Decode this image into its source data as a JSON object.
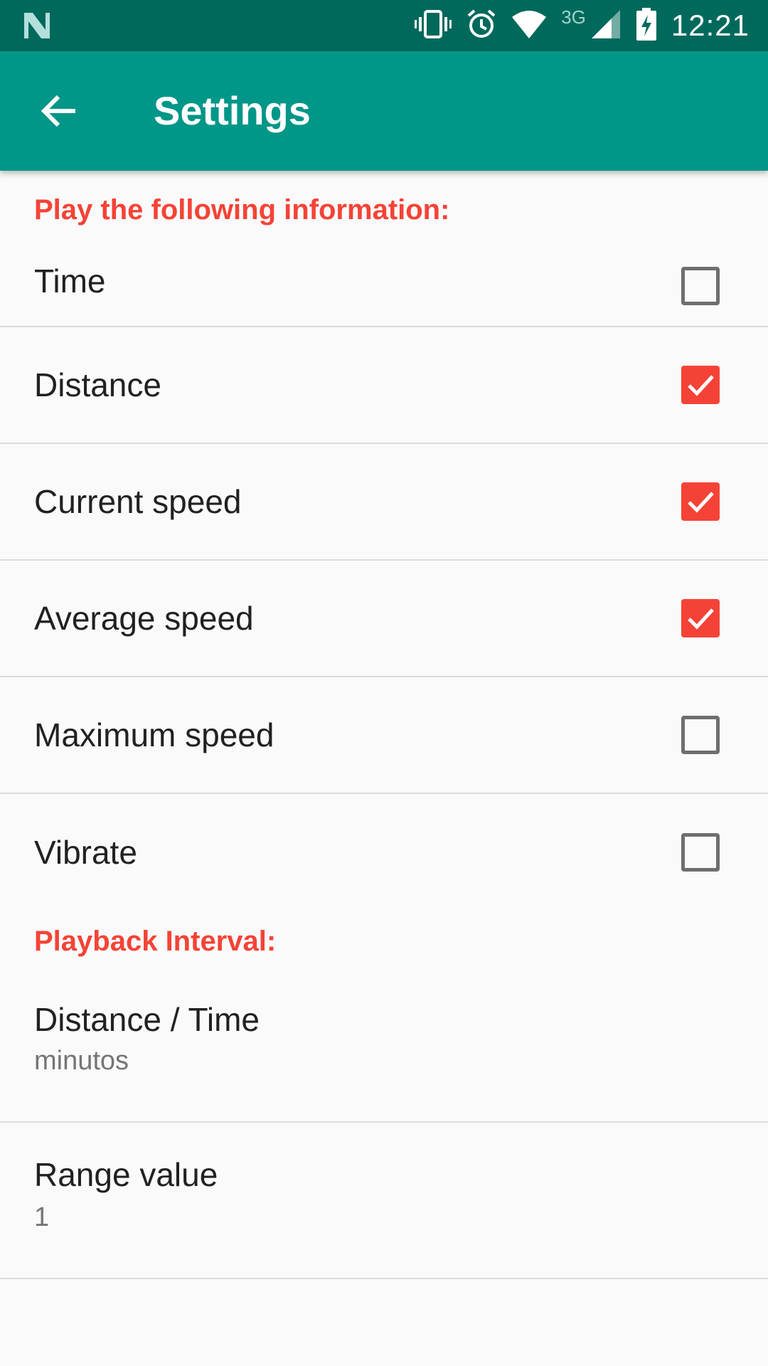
{
  "status_bar": {
    "left_icon": "notification-n-icon",
    "icons": [
      "vibrate-icon",
      "alarm-icon",
      "wifi-icon",
      "signal-icon",
      "battery-charging-icon"
    ],
    "network_type": "3G",
    "time": "12:21"
  },
  "app_bar": {
    "title": "Settings",
    "back_icon": "arrow-back-icon",
    "color": "#009688",
    "status_color": "#00695c"
  },
  "section_play": {
    "header": "Play the following information:",
    "items": [
      {
        "label": "Time",
        "checked": false
      },
      {
        "label": "Distance",
        "checked": true
      },
      {
        "label": "Current speed",
        "checked": true
      },
      {
        "label": "Average speed",
        "checked": true
      },
      {
        "label": "Maximum speed",
        "checked": false
      },
      {
        "label": "Vibrate",
        "checked": false
      }
    ]
  },
  "section_interval": {
    "header": "Playback Interval:",
    "items": [
      {
        "label": "Distance / Time",
        "summary": "minutos"
      },
      {
        "label": "Range value",
        "summary": "1"
      }
    ]
  },
  "colors": {
    "accent": "#f44336",
    "background": "#fafafa"
  }
}
